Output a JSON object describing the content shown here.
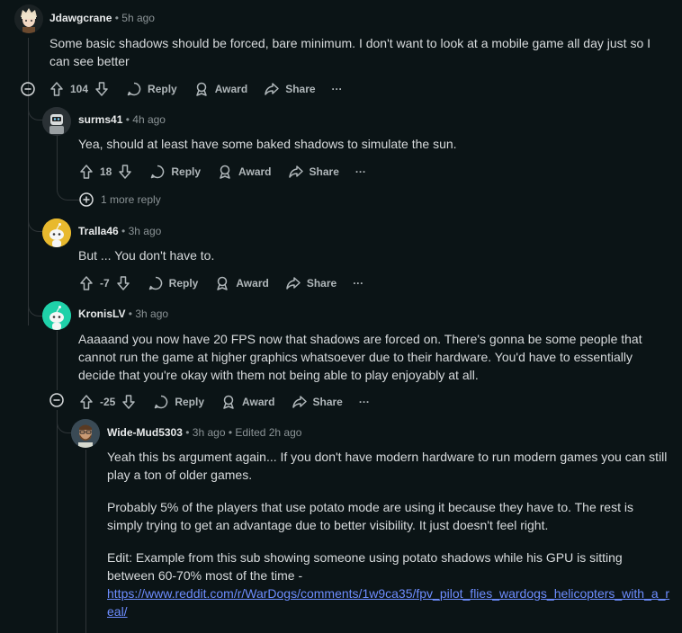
{
  "ui": {
    "reply_label": "Reply",
    "award_label": "Award",
    "share_label": "Share",
    "more_label": "···",
    "separator": "•",
    "colors": {
      "background": "#0b1416",
      "link": "#6d8dff",
      "username": "#e8eaeb",
      "meta": "#8b9396",
      "body": "#d7dadc"
    }
  },
  "comments": [
    {
      "username": "Jdawgcrane",
      "age": "5h ago",
      "text": "Some basic shadows should be forced, bare minimum. I don't want to look at a mobile game all day just so I can see better",
      "votes": "104",
      "avatar_icon": "anime-avatar-icon"
    },
    {
      "username": "surms41",
      "age": "4h ago",
      "text": "Yea, should at least have some baked shadows to simulate the sun.",
      "votes": "18",
      "more_replies": "1 more reply",
      "avatar_icon": "robot-avatar-icon"
    },
    {
      "username": "Tralla46",
      "age": "3h ago",
      "text": "But ... You don't have to.",
      "votes": "-7",
      "avatar_icon": "snoo-yellow-avatar-icon"
    },
    {
      "username": "KronisLV",
      "age": "3h ago",
      "text": "Aaaaand you now have 20 FPS now that shadows are forced on. There's gonna be some people that cannot run the game at higher graphics whatsoever due to their hardware. You'd have to essentially decide that you're okay with them not being able to play enjoyably at all.",
      "votes": "-25",
      "avatar_icon": "snoo-teal-avatar-icon"
    },
    {
      "username": "Wide-Mud5303",
      "age": "3h ago",
      "edited": "Edited 2h ago",
      "paragraphs": [
        "Yeah this bs argument again... If you don't have modern hardware to run modern games you can still play a ton of older games.",
        "Probably 5% of the players that use potato mode are using it because they have to. The rest is simply trying to get an advantage due to better visibility. It just doesn't feel right.",
        "Edit: Example from this sub showing someone using potato shadows while his GPU is sitting between 60-70% most of the time -"
      ],
      "link": "https://www.reddit.com/r/WarDogs/comments/1w9ca35/fpv_pilot_flies_wardogs_helicopters_with_a_real/",
      "avatar_icon": "bearded-man-avatar-icon"
    }
  ]
}
